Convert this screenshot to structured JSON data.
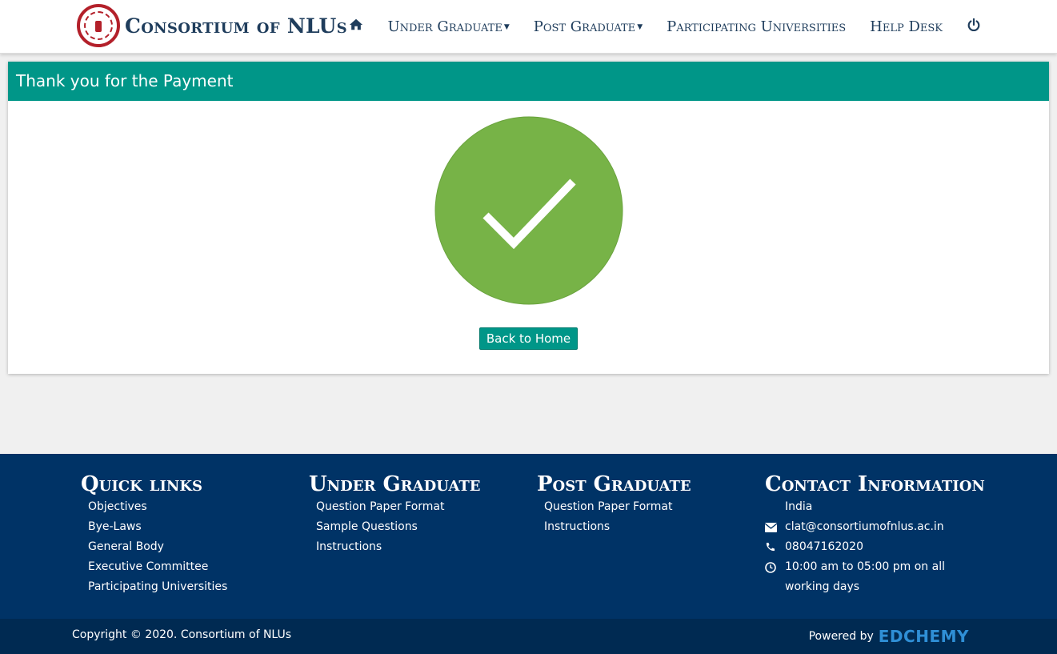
{
  "header": {
    "brand": "Consortium of NLUs",
    "nav": {
      "home_icon": "home-icon",
      "under_graduate": "Under Graduate",
      "post_graduate": "Post Graduate",
      "participating_universities": "Participating Universities",
      "help_desk": "Help Desk",
      "power_icon": "power-icon"
    }
  },
  "panel": {
    "title": "Thank you for the Payment",
    "status_icon": "check-circle-icon",
    "status_color": "#77b347",
    "back_button": "Back to Home"
  },
  "footer": {
    "quick_links": {
      "title": "Quick links",
      "items": [
        "Objectives",
        "Bye-Laws",
        "General Body",
        "Executive Committee",
        "Participating Universities"
      ]
    },
    "under_graduate": {
      "title": "Under Graduate",
      "items": [
        "Question Paper Format",
        "Sample Questions",
        "Instructions"
      ]
    },
    "post_graduate": {
      "title": "Post Graduate",
      "items": [
        "Question Paper Format",
        "Instructions"
      ]
    },
    "contact": {
      "title": "Contact Information",
      "country": "India",
      "email": "clat@consortiumofnlus.ac.in",
      "phone": "08047162020",
      "hours": "10:00 am to 05:00 pm on all working days"
    },
    "copyright": "Copyright © 2020. Consortium of NLUs",
    "powered_by": "Powered by",
    "powered_brand": "EDCHEMY"
  },
  "colors": {
    "accent": "#009688",
    "navy": "#003366",
    "navy_dark": "#002a52",
    "brand_text": "#1f3d5c"
  }
}
